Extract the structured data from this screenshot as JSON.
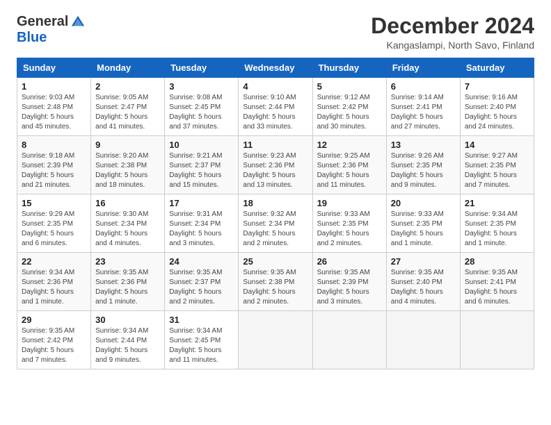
{
  "header": {
    "logo_general": "General",
    "logo_blue": "Blue",
    "month_title": "December 2024",
    "location": "Kangaslampi, North Savo, Finland"
  },
  "days_of_week": [
    "Sunday",
    "Monday",
    "Tuesday",
    "Wednesday",
    "Thursday",
    "Friday",
    "Saturday"
  ],
  "weeks": [
    [
      {
        "num": "1",
        "sunrise": "9:03 AM",
        "sunset": "2:48 PM",
        "daylight": "5 hours and 45 minutes."
      },
      {
        "num": "2",
        "sunrise": "9:05 AM",
        "sunset": "2:47 PM",
        "daylight": "5 hours and 41 minutes."
      },
      {
        "num": "3",
        "sunrise": "9:08 AM",
        "sunset": "2:45 PM",
        "daylight": "5 hours and 37 minutes."
      },
      {
        "num": "4",
        "sunrise": "9:10 AM",
        "sunset": "2:44 PM",
        "daylight": "5 hours and 33 minutes."
      },
      {
        "num": "5",
        "sunrise": "9:12 AM",
        "sunset": "2:42 PM",
        "daylight": "5 hours and 30 minutes."
      },
      {
        "num": "6",
        "sunrise": "9:14 AM",
        "sunset": "2:41 PM",
        "daylight": "5 hours and 27 minutes."
      },
      {
        "num": "7",
        "sunrise": "9:16 AM",
        "sunset": "2:40 PM",
        "daylight": "5 hours and 24 minutes."
      }
    ],
    [
      {
        "num": "8",
        "sunrise": "9:18 AM",
        "sunset": "2:39 PM",
        "daylight": "5 hours and 21 minutes."
      },
      {
        "num": "9",
        "sunrise": "9:20 AM",
        "sunset": "2:38 PM",
        "daylight": "5 hours and 18 minutes."
      },
      {
        "num": "10",
        "sunrise": "9:21 AM",
        "sunset": "2:37 PM",
        "daylight": "5 hours and 15 minutes."
      },
      {
        "num": "11",
        "sunrise": "9:23 AM",
        "sunset": "2:36 PM",
        "daylight": "5 hours and 13 minutes."
      },
      {
        "num": "12",
        "sunrise": "9:25 AM",
        "sunset": "2:36 PM",
        "daylight": "5 hours and 11 minutes."
      },
      {
        "num": "13",
        "sunrise": "9:26 AM",
        "sunset": "2:35 PM",
        "daylight": "5 hours and 9 minutes."
      },
      {
        "num": "14",
        "sunrise": "9:27 AM",
        "sunset": "2:35 PM",
        "daylight": "5 hours and 7 minutes."
      }
    ],
    [
      {
        "num": "15",
        "sunrise": "9:29 AM",
        "sunset": "2:35 PM",
        "daylight": "5 hours and 6 minutes."
      },
      {
        "num": "16",
        "sunrise": "9:30 AM",
        "sunset": "2:34 PM",
        "daylight": "5 hours and 4 minutes."
      },
      {
        "num": "17",
        "sunrise": "9:31 AM",
        "sunset": "2:34 PM",
        "daylight": "5 hours and 3 minutes."
      },
      {
        "num": "18",
        "sunrise": "9:32 AM",
        "sunset": "2:34 PM",
        "daylight": "5 hours and 2 minutes."
      },
      {
        "num": "19",
        "sunrise": "9:33 AM",
        "sunset": "2:35 PM",
        "daylight": "5 hours and 2 minutes."
      },
      {
        "num": "20",
        "sunrise": "9:33 AM",
        "sunset": "2:35 PM",
        "daylight": "5 hours and 1 minute."
      },
      {
        "num": "21",
        "sunrise": "9:34 AM",
        "sunset": "2:35 PM",
        "daylight": "5 hours and 1 minute."
      }
    ],
    [
      {
        "num": "22",
        "sunrise": "9:34 AM",
        "sunset": "2:36 PM",
        "daylight": "5 hours and 1 minute."
      },
      {
        "num": "23",
        "sunrise": "9:35 AM",
        "sunset": "2:36 PM",
        "daylight": "5 hours and 1 minute."
      },
      {
        "num": "24",
        "sunrise": "9:35 AM",
        "sunset": "2:37 PM",
        "daylight": "5 hours and 2 minutes."
      },
      {
        "num": "25",
        "sunrise": "9:35 AM",
        "sunset": "2:38 PM",
        "daylight": "5 hours and 2 minutes."
      },
      {
        "num": "26",
        "sunrise": "9:35 AM",
        "sunset": "2:39 PM",
        "daylight": "5 hours and 3 minutes."
      },
      {
        "num": "27",
        "sunrise": "9:35 AM",
        "sunset": "2:40 PM",
        "daylight": "5 hours and 4 minutes."
      },
      {
        "num": "28",
        "sunrise": "9:35 AM",
        "sunset": "2:41 PM",
        "daylight": "5 hours and 6 minutes."
      }
    ],
    [
      {
        "num": "29",
        "sunrise": "9:35 AM",
        "sunset": "2:42 PM",
        "daylight": "5 hours and 7 minutes."
      },
      {
        "num": "30",
        "sunrise": "9:34 AM",
        "sunset": "2:44 PM",
        "daylight": "5 hours and 9 minutes."
      },
      {
        "num": "31",
        "sunrise": "9:34 AM",
        "sunset": "2:45 PM",
        "daylight": "5 hours and 11 minutes."
      },
      null,
      null,
      null,
      null
    ]
  ]
}
